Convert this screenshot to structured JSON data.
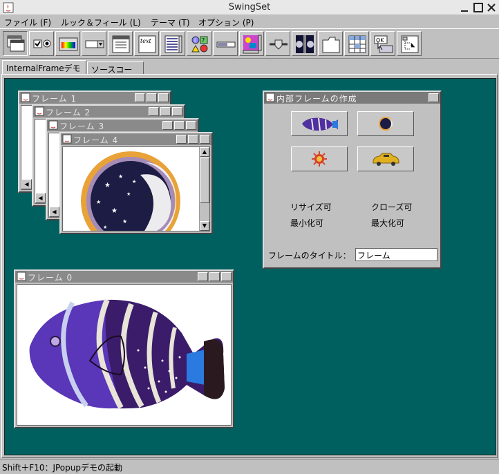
{
  "window": {
    "title": "SwingSet"
  },
  "menu": [
    "ファイル (F)",
    "ルック＆フィール (L)",
    "テーマ (T)",
    "オプション (P)"
  ],
  "tabs": [
    "InternalFrameデモ",
    "ソースコード"
  ],
  "frames": [
    {
      "title": "フレーム 0"
    },
    {
      "title": "フレーム 1"
    },
    {
      "title": "フレーム 2"
    },
    {
      "title": "フレーム 3"
    },
    {
      "title": "フレーム 4"
    }
  ],
  "control_panel": {
    "title": "内部フレームの作成",
    "checks": {
      "resizable": "リサイズ可",
      "closable": "クローズ可",
      "iconifiable": "最小化可",
      "maximizable": "最大化可"
    },
    "frame_title_label": "フレームのタイトル：",
    "frame_title_value": "フレーム"
  },
  "status": "Shift＋F10：JPopupデモの起動",
  "colors": {
    "desktop": "#005f5f",
    "chrome": "#c0c0c0"
  }
}
